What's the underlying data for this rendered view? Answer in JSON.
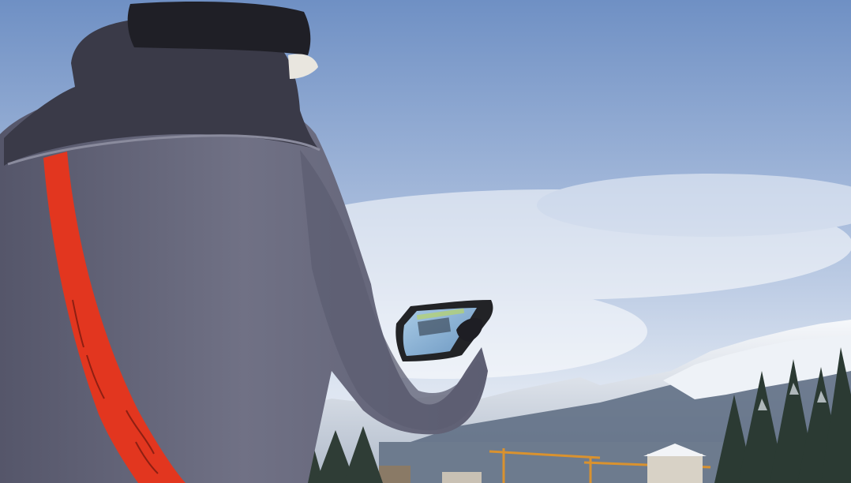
{
  "scene": {
    "description_tags": [
      "person",
      "tablet",
      "snowy-mountains",
      "sky",
      "pine-trees",
      "village",
      "construction-crane"
    ],
    "colors": {
      "sky_top": "#6f90c4",
      "sky_bottom": "#e9eef6",
      "jacket": "#6f7083",
      "jacket_shadow": "#55566a",
      "hood": "#3a3a48",
      "strap": "#e2361f",
      "beanie": "#1f1f26",
      "tablet_frame": "#222326",
      "tablet_screen": "#8fb6d8",
      "snow": "#f4f7fb",
      "rock": "#4d5a6e",
      "trees": "#2d3a34",
      "crane": "#d9922f"
    }
  }
}
